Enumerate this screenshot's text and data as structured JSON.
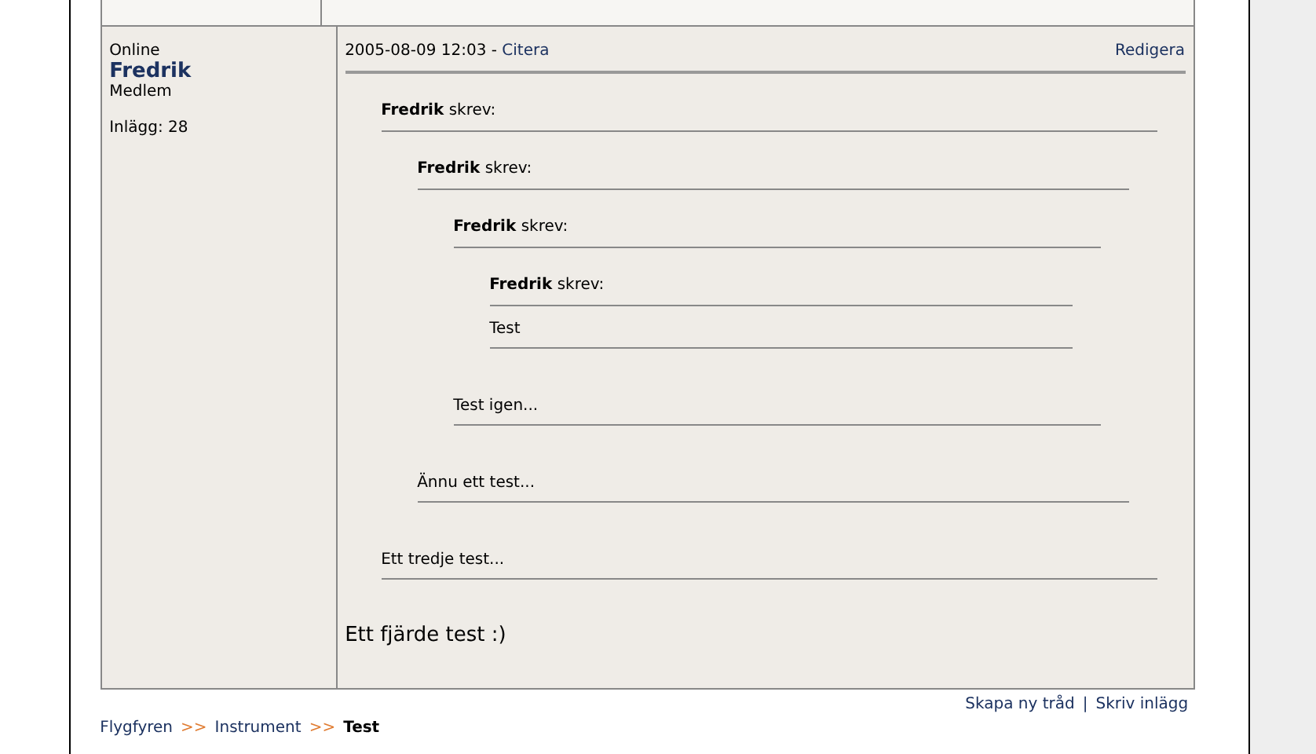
{
  "post": {
    "author_status": "Online",
    "author": "Fredrik",
    "role": "Medlem",
    "post_count": "Inlägg: 28",
    "date": "2005-08-09 12:03 -",
    "quote_link": "Citera",
    "edit_link": "Redigera",
    "quote": {
      "header": "**Fredrik** skrev:",
      "quote": {
        "header": "**Fredrik** skrev:",
        "quote": {
          "header": "**Fredrik** skrev:",
          "quote": {
            "header": "**Fredrik** skrev:",
            "text": "Test"
          },
          "text": "Test igen..."
        },
        "text": "Ännu ett test..."
      },
      "text": "Ett tredje test..."
    },
    "text": "Ett fjärde test :)"
  },
  "actions": [
    "Skapa ny tråd",
    "Skriv inlägg"
  ],
  "actions_separator": "|",
  "breadcrumb": [
    {
      "label": "Flygfyren",
      "current": false
    },
    {
      "label": "Instrument",
      "current": false
    },
    {
      "label": "Test",
      "current": true
    }
  ],
  "breadcrumb_separator": ">>"
}
